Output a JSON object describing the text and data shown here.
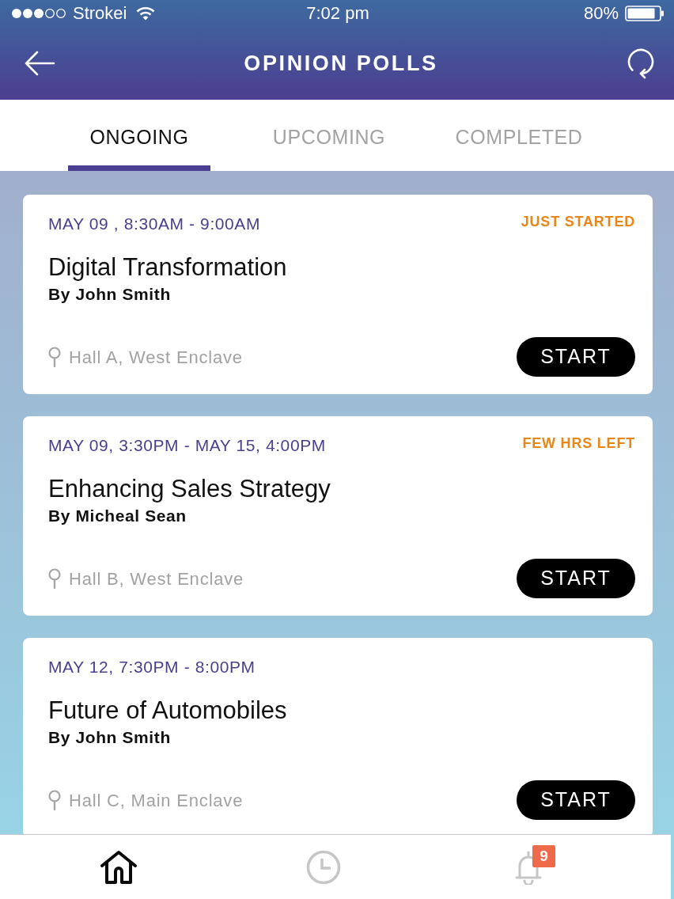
{
  "status_bar": {
    "carrier": "Strokei",
    "time": "7:02 pm",
    "battery": "80%"
  },
  "header": {
    "title": "OPINION POLLS"
  },
  "tabs": [
    {
      "label": "ONGOING",
      "selected": true
    },
    {
      "label": "UPCOMING",
      "selected": false
    },
    {
      "label": "COMPLETED",
      "selected": false
    }
  ],
  "polls": [
    {
      "schedule": "MAY 09 , 8:30AM - 9:00AM",
      "status": "JUST STARTED",
      "title": "Digital Transformation",
      "author": "By John Smith",
      "location": "Hall A, West Enclave",
      "button": "START"
    },
    {
      "schedule": "MAY 09, 3:30PM - MAY 15, 4:00PM",
      "status": "FEW HRS LEFT",
      "title": "Enhancing Sales Strategy",
      "author": "By Micheal Sean",
      "location": "Hall B, West Enclave",
      "button": "START"
    },
    {
      "schedule": "MAY 12, 7:30PM - 8:00PM",
      "title": "Future of Automobiles",
      "author": "By John Smith",
      "location": "Hall C, Main Enclave",
      "button": "START"
    }
  ],
  "bottom_nav": [
    {
      "kind": "home",
      "selected": true
    },
    {
      "kind": "history",
      "selected": false
    },
    {
      "kind": "notifications",
      "selected": false,
      "badge": "9"
    }
  ]
}
